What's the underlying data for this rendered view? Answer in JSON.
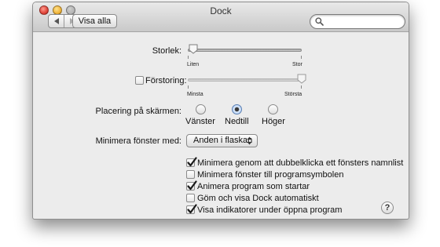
{
  "window": {
    "title": "Dock"
  },
  "toolbar": {
    "show_all_label": "Visa alla",
    "search": {
      "value": "",
      "placeholder": ""
    }
  },
  "size": {
    "label": "Storlek:",
    "min_label": "Liten",
    "max_label": "Stor",
    "value": 0.05
  },
  "magnification": {
    "label": "Förstoring:",
    "enabled": false,
    "min_label": "Minsta",
    "max_label": "Största",
    "value": 1.0
  },
  "position": {
    "label": "Placering på skärmen:",
    "options": [
      {
        "label": "Vänster",
        "selected": false
      },
      {
        "label": "Nedtill",
        "selected": true
      },
      {
        "label": "Höger",
        "selected": false
      }
    ]
  },
  "minimize_effect": {
    "label": "Minimera fönster med:",
    "value": "Anden i flaskan"
  },
  "options": [
    {
      "label": "Minimera genom att dubbelklicka ett fönsters namnlist",
      "checked": true
    },
    {
      "label": "Minimera fönster till programsymbolen",
      "checked": false
    },
    {
      "label": "Animera program som startar",
      "checked": true
    },
    {
      "label": "Göm och visa Dock automatiskt",
      "checked": false
    },
    {
      "label": "Visa indikatorer under öppna program",
      "checked": true
    }
  ],
  "help": {
    "label": "?"
  },
  "colors": {
    "accent": "#3b6fc7",
    "window_bg": "#ececec"
  }
}
